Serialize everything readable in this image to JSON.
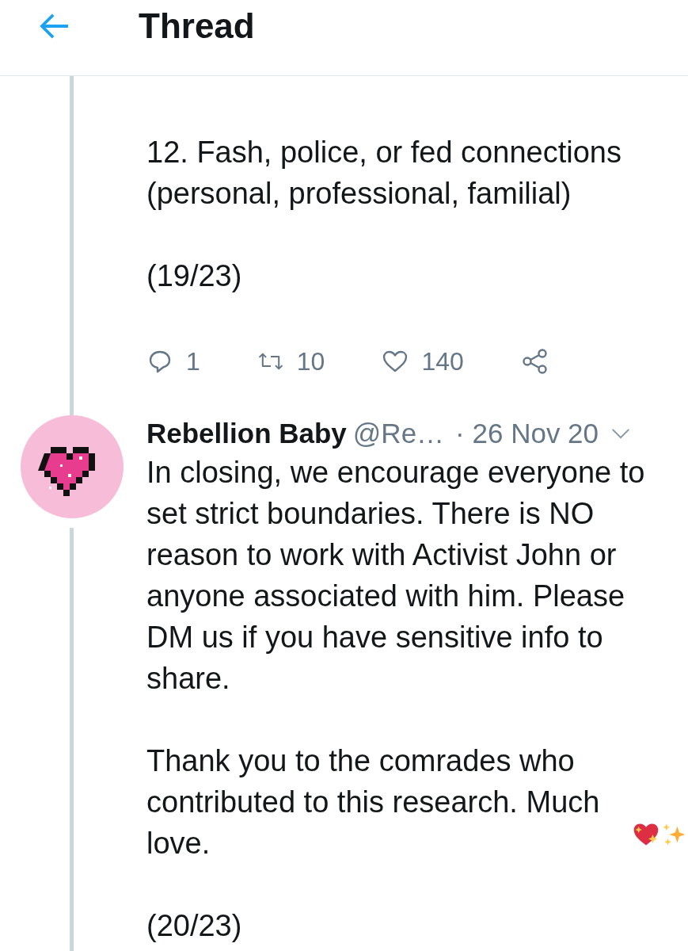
{
  "header": {
    "title": "Thread"
  },
  "tweets": [
    {
      "kind": "continued",
      "paragraphs": [
        "12. Fash, police, or fed connections (personal, professional, familial)",
        "(19/23)"
      ],
      "actions": {
        "replies": "1",
        "retweets": "10",
        "likes": "140"
      }
    },
    {
      "kind": "full",
      "author": "Rebellion Baby",
      "handle": "@Re…",
      "date": "· 26 Nov 20",
      "paragraphs": [
        "In closing, we encourage everyone to set strict boundaries. There is NO reason to work with Activist John or anyone associated with him. Please DM us if you have sensitive info to share.",
        "Thank you to the comrades who contributed to this research. Much love.",
        "(20/23)"
      ]
    }
  ]
}
